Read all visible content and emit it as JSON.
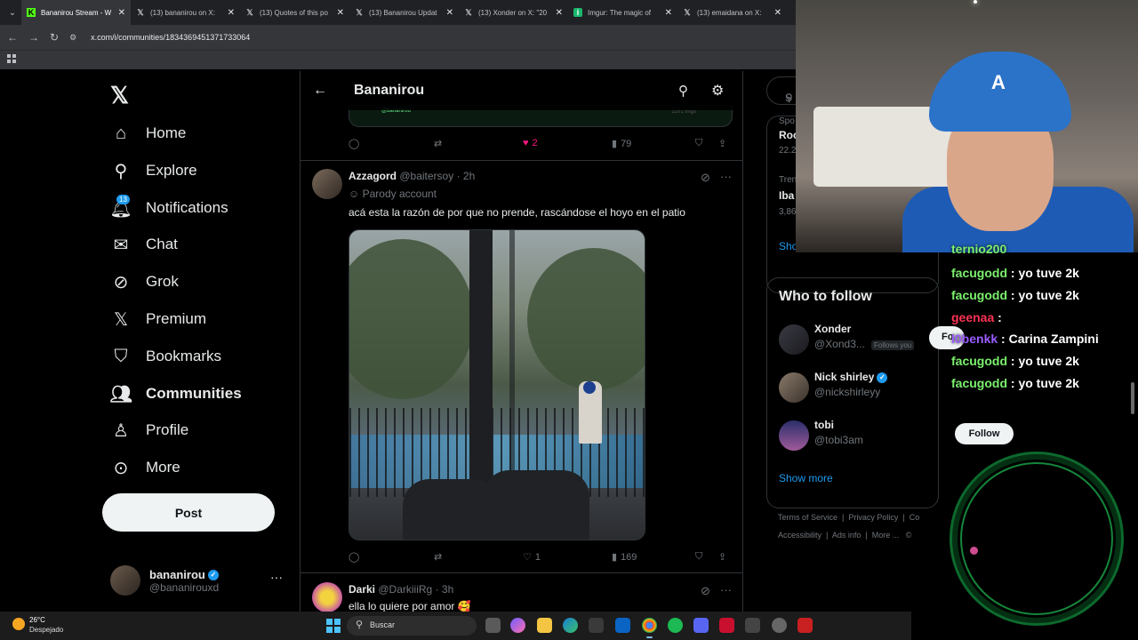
{
  "browser": {
    "tabs": [
      {
        "label": "Bananirou Stream - W",
        "icon": "kick-icon",
        "active": true
      },
      {
        "label": "(13) bananirou on X:",
        "icon": "x-icon",
        "active": false
      },
      {
        "label": "(13) Quotes of this po",
        "icon": "x-icon",
        "active": false
      },
      {
        "label": "(13) Bananirou Updat",
        "icon": "x-icon",
        "active": false
      },
      {
        "label": "(13) Xonder on X: \"20",
        "icon": "x-icon",
        "active": false
      },
      {
        "label": "Imgur: The magic of",
        "icon": "imgur-icon",
        "active": false
      },
      {
        "label": "(13) emaidana on X:",
        "icon": "x-icon",
        "active": false
      }
    ],
    "url": "x.com/i/communities/1834369451371733064"
  },
  "nav": {
    "items": [
      {
        "label": "Home",
        "icon": "home-icon"
      },
      {
        "label": "Explore",
        "icon": "search-icon"
      },
      {
        "label": "Notifications",
        "icon": "bell-icon",
        "badge": "13"
      },
      {
        "label": "Chat",
        "icon": "mail-icon"
      },
      {
        "label": "Grok",
        "icon": "grok-icon"
      },
      {
        "label": "Premium",
        "icon": "x-logo-icon"
      },
      {
        "label": "Bookmarks",
        "icon": "bookmark-icon"
      },
      {
        "label": "Communities",
        "icon": "communities-icon",
        "active": true
      },
      {
        "label": "Profile",
        "icon": "person-icon"
      },
      {
        "label": "More",
        "icon": "more-circle-icon"
      }
    ],
    "post_label": "Post",
    "me": {
      "name": "bananirou",
      "handle": "@bananirouxd"
    }
  },
  "main": {
    "title": "Bananirou",
    "prev_card": {
      "text": "@bananirou",
      "meta": "2201 imgs"
    },
    "prev_actions": {
      "likes": "2",
      "views": "79"
    },
    "tweets": [
      {
        "name": "Azzagord",
        "handle": "@baitersoy",
        "time": "2h",
        "label": "Parody account",
        "text": "acá esta la razón de por que no prende, rascándose el hoyo en el patio",
        "likes": "1",
        "views": "169"
      },
      {
        "name": "Darki",
        "handle": "@DarkiiiRg",
        "time": "3h",
        "text": "ella lo quiere por amor 🥰"
      }
    ]
  },
  "right": {
    "search_placeholder": "S",
    "trends": [
      {
        "line1": "Spo",
        "line2": "Roc",
        "line3": "22.2"
      },
      {
        "line1": "Tren",
        "line2": "Iba",
        "line3": "3,86"
      }
    ],
    "trends_show": "Sho",
    "who_to_follow": "Who to follow",
    "follows": [
      {
        "name": "Xonder",
        "handle": "@Xond3...",
        "tag": "Follows you",
        "button": "Fo"
      },
      {
        "name": "Nick shirley",
        "handle": "@nickshirleyy",
        "verified": true
      },
      {
        "name": "tobi",
        "handle": "@tobi3am",
        "button": "Follow"
      }
    ],
    "show_more": "Show more",
    "footer1": [
      "Terms of Service",
      "Privacy Policy",
      "Co"
    ],
    "footer2": [
      "Accessibility",
      "Ads info",
      "More ...",
      "©"
    ]
  },
  "chat": {
    "lines": [
      {
        "user": "ternio200",
        "msg": ""
      },
      {
        "user": "facugodd",
        "msg": ": yo tuve 2k"
      },
      {
        "user": "facugodd",
        "msg": ": yo tuve 2k"
      },
      {
        "user": "geenaa",
        "msg": ":"
      },
      {
        "user": "l0benkk",
        "msg": ": Carina Zampini"
      },
      {
        "user": "facugodd",
        "msg": ": yo tuve 2k"
      },
      {
        "user": "facugodd",
        "msg": ": yo tuve 2k"
      }
    ]
  },
  "taskbar": {
    "temp": "26°C",
    "weather": "Despejado",
    "search": "Buscar"
  },
  "colors": {
    "accent": "#1d9bf0",
    "like": "#f91880",
    "chat_green": "#7cf06d"
  }
}
